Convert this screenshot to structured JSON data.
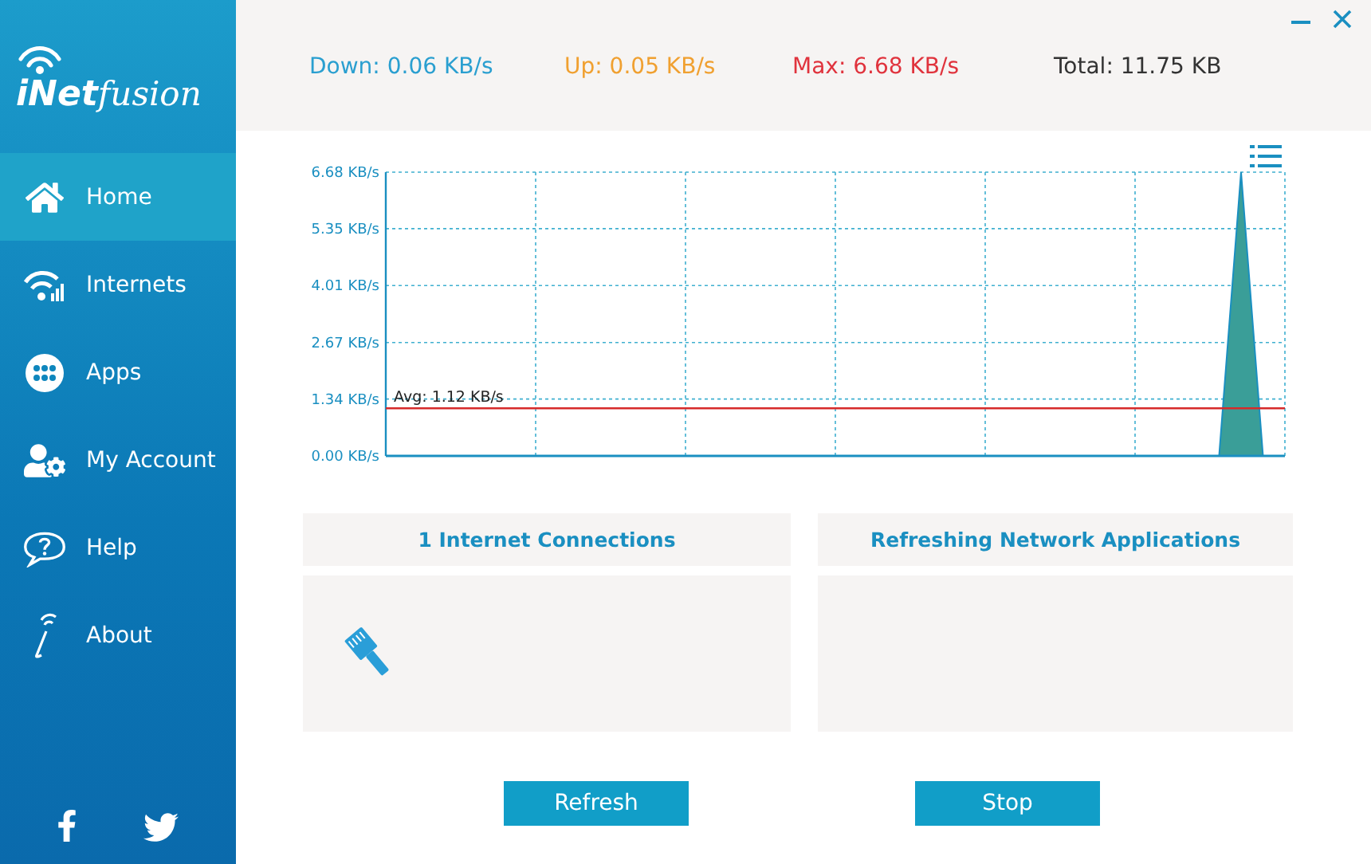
{
  "logo": {
    "main": "iNet",
    "script": "fusion"
  },
  "sidebar": {
    "items": [
      {
        "label": "Home",
        "selected": true
      },
      {
        "label": "Internets",
        "selected": false
      },
      {
        "label": "Apps",
        "selected": false
      },
      {
        "label": "My Account",
        "selected": false
      },
      {
        "label": "Help",
        "selected": false
      },
      {
        "label": "About",
        "selected": false
      }
    ]
  },
  "stats": [
    {
      "text": "Down: 0.06 KB/s",
      "color": "#2a9fd0"
    },
    {
      "text": "Up: 0.05 KB/s",
      "color": "#f0a030"
    },
    {
      "text": "Max: 6.68 KB/s",
      "color": "#e0333d"
    },
    {
      "text": "Total: 11.75 KB",
      "color": "#333333"
    }
  ],
  "chart": {
    "chart_data": {
      "type": "area",
      "ylim": [
        0,
        6.68
      ],
      "yticks": [
        {
          "value": 0,
          "label": "0.00 KB/s"
        },
        {
          "value": 1.34,
          "label": "1.34 KB/s"
        },
        {
          "value": 2.67,
          "label": "2.67 KB/s"
        },
        {
          "value": 4.01,
          "label": "4.01 KB/s"
        },
        {
          "value": 5.35,
          "label": "5.35 KB/s"
        },
        {
          "value": 6.68,
          "label": "6.68 KB/s"
        }
      ],
      "grid": true,
      "series": [
        {
          "color": "#3a9e98",
          "values": [
            0,
            0,
            0,
            0,
            0,
            0,
            0,
            0,
            0,
            0,
            0,
            0,
            0,
            0,
            0,
            0,
            0,
            0,
            0,
            0,
            0,
            0,
            0,
            0,
            0,
            0,
            0,
            0,
            0,
            0,
            0,
            0,
            0,
            0,
            0,
            0,
            0,
            0,
            0,
            6.68,
            0,
            0
          ]
        },
        {
          "type": "line",
          "color": "#d62a2a",
          "values": [
            1.12,
            1.12,
            1.12,
            1.12,
            1.12,
            1.12,
            1.12,
            1.12,
            1.12,
            1.12,
            1.12,
            1.12,
            1.12,
            1.12,
            1.12,
            1.12,
            1.12,
            1.12,
            1.12,
            1.12,
            1.12,
            1.12,
            1.12,
            1.12,
            1.12,
            1.12,
            1.12,
            1.12,
            1.12,
            1.12,
            1.12,
            1.12,
            1.12,
            1.12,
            1.12,
            1.12,
            1.12,
            1.12,
            1.12,
            1.12,
            1.12,
            1.12
          ]
        }
      ],
      "annotations": [
        "Avg: 1.12 KB/s"
      ]
    }
  },
  "panels": [
    {
      "title": "1 Internet Connections",
      "items": [
        {
          "kind": "ethernet"
        }
      ]
    },
    {
      "title": "Refreshing Network Applications"
    }
  ],
  "buttons": [
    "Refresh",
    "Stop"
  ]
}
